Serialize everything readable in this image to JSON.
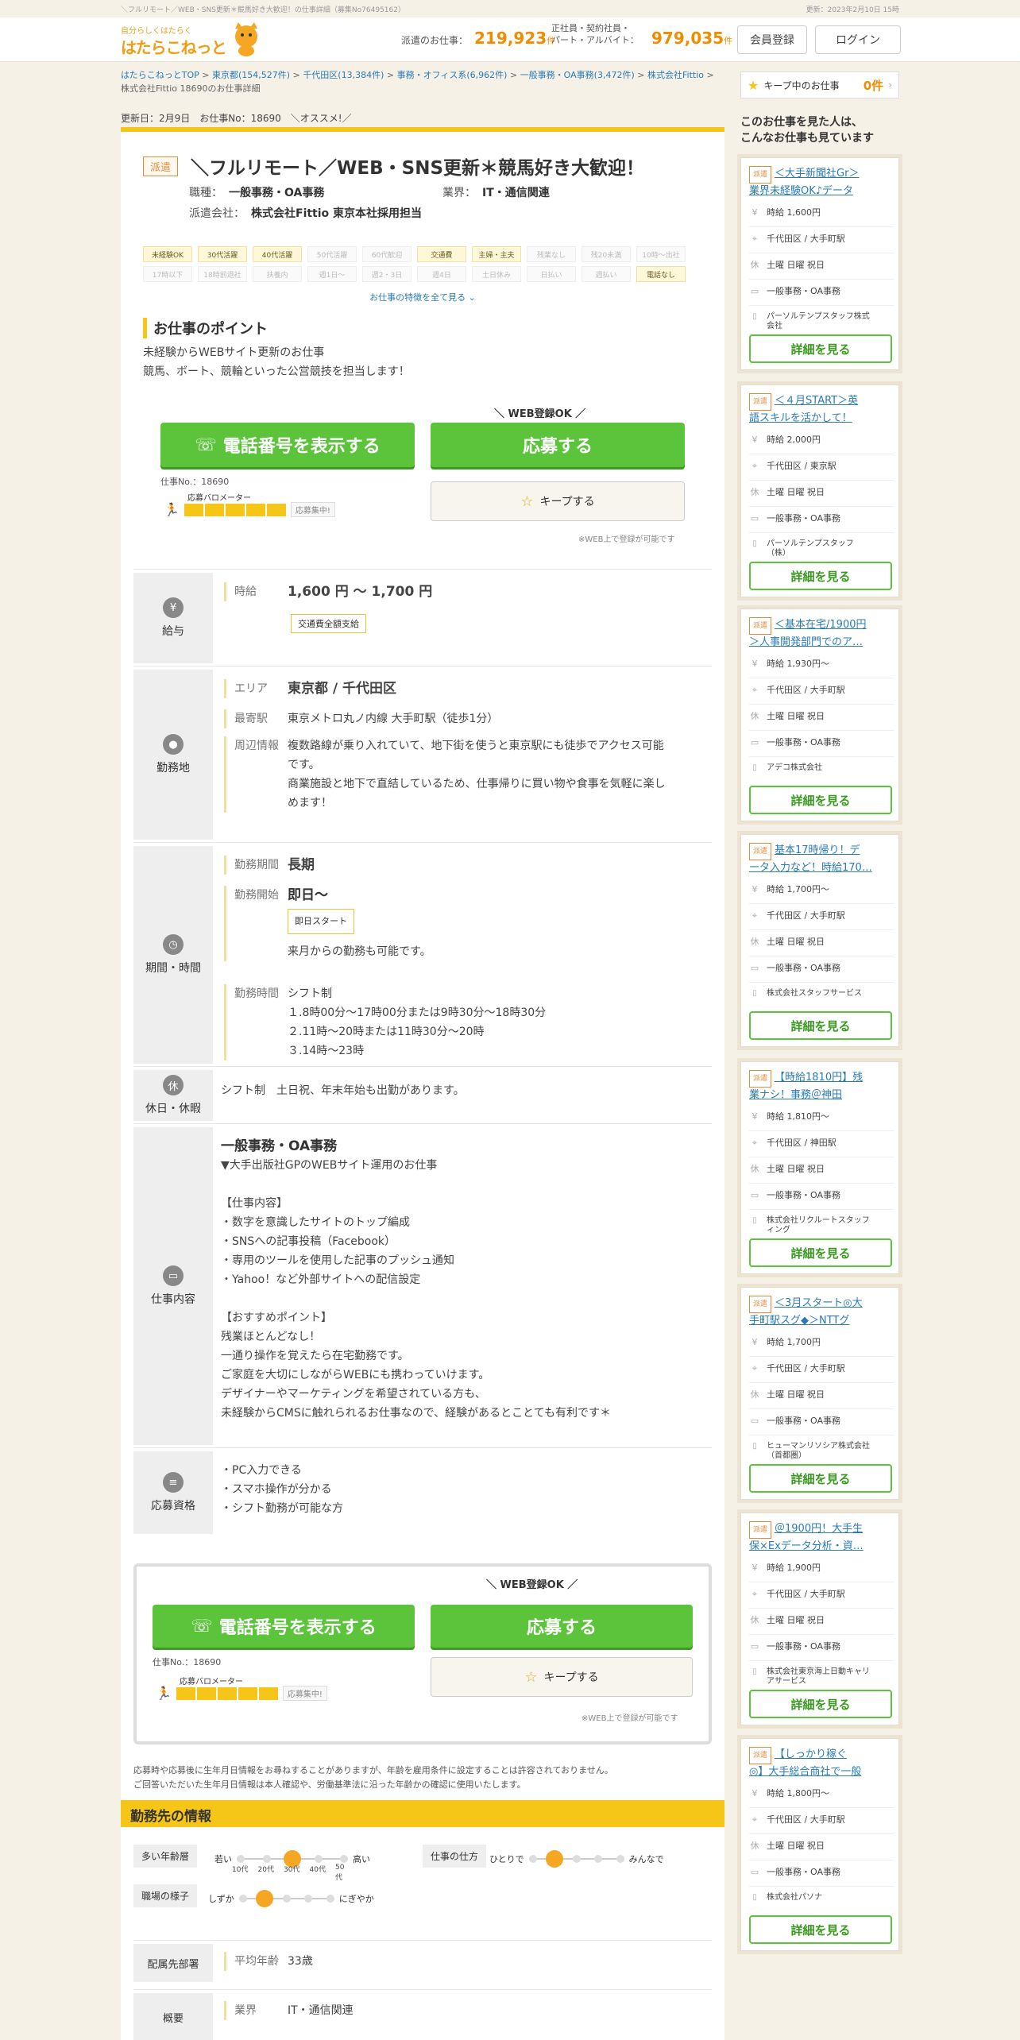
{
  "top": {
    "left": "＼フルリモート／WEB・SNS更新＊競馬好き大歓迎！の仕事詳細（募集No76495162）",
    "right": "更新：2023年2月10日 15時"
  },
  "header": {
    "logo_tagline": "自分らしくはたらく",
    "logo_name": "はたらこねっと",
    "haken_label": "派遣のお仕事：",
    "haken_count": "219,923",
    "seishain_label_1": "正社員・契約社員・",
    "seishain_label_2": "パート・アルバイト：",
    "seishain_count": "979,035",
    "ken": "件",
    "register": "会員登録",
    "login": "ログイン"
  },
  "breadcrumb": [
    "はたらこねっとTOP",
    "東京都(154,527件)",
    "千代田区(13,384件)",
    "事務・オフィス系(6,962件)",
    "一般事務・OA事務(3,472件)",
    "株式会社Fittio",
    "株式会社Fittio 18690のお仕事詳細"
  ],
  "updated": "更新日：2月9日　お仕事No：18690　＼オススメ!／",
  "job": {
    "badge": "派遣",
    "title": "＼フルリモート／WEB・SNS更新＊競馬好き大歓迎！",
    "shokushu_label": "職種：",
    "shokushu": "一般事務・OA事務",
    "gyokai_label": "業界：",
    "gyokai": "IT・通信関連",
    "company_label": "派遣会社：",
    "company": "株式会社Fittio 東京本社採用担当"
  },
  "features": [
    {
      "label": "未経験OK",
      "on": true
    },
    {
      "label": "30代活躍",
      "on": true
    },
    {
      "label": "40代活躍",
      "on": true
    },
    {
      "label": "50代活躍",
      "on": false
    },
    {
      "label": "60代歓迎",
      "on": false
    },
    {
      "label": "交通費",
      "on": true
    },
    {
      "label": "主婦・主夫",
      "on": true
    },
    {
      "label": "残業なし",
      "on": false
    },
    {
      "label": "残20未満",
      "on": false
    },
    {
      "label": "10時～出社",
      "on": false
    },
    {
      "label": "17時以下",
      "on": false
    },
    {
      "label": "18時前退社",
      "on": false
    },
    {
      "label": "扶養内",
      "on": false
    },
    {
      "label": "週1日～",
      "on": false
    },
    {
      "label": "週2・3日",
      "on": false
    },
    {
      "label": "週4日",
      "on": false
    },
    {
      "label": "土日休み",
      "on": false
    },
    {
      "label": "日払い",
      "on": false
    },
    {
      "label": "週払い",
      "on": false
    },
    {
      "label": "電話なし",
      "on": true
    }
  ],
  "more_features": "お仕事の特徴を全て見る ⌄",
  "point": {
    "heading": "お仕事のポイント",
    "line1": "未経験からWEBサイト更新のお仕事",
    "line2": "競馬、ボート、競輪といった公営競技を担当します！"
  },
  "cta": {
    "web_ok": "＼ WEB登録OK ／",
    "phone": "電話番号を表示する",
    "apply": "応募する",
    "keep": "キープする",
    "job_no": "仕事No.：18690",
    "barometer": "応募バロメーター",
    "barometer_status": "応募集中!",
    "barometer_level": 5,
    "note": "※WEB上で登録が可能です"
  },
  "salary": {
    "heading": "給与",
    "label": "時給",
    "value": "1,600 円 ～ 1,700 円",
    "tag": "交通費全額支給"
  },
  "location": {
    "heading": "勤務地",
    "area_label": "エリア",
    "area": "東京都 / 千代田区",
    "station_label": "最寄駅",
    "station": "東京メトロ丸ノ内線 大手町駅（徒歩1分）",
    "info_label": "周辺情報",
    "info1": "複数路線が乗り入れていて、地下街を使うと東京駅にも徒歩でアクセス可能",
    "info2": "です。",
    "info3": "商業施設と地下で直結しているため、仕事帰りに買い物や食事を気軽に楽し",
    "info4": "めます！"
  },
  "period": {
    "heading": "期間・時間",
    "duration_label": "勤務期間",
    "duration": "長期",
    "start_label": "勤務開始",
    "start": "即日～",
    "start_tag": "即日スタート",
    "start_note": "来月からの勤務も可能です。",
    "hours_label": "勤務時間",
    "hours1": "シフト制",
    "hours2": "１.8時00分～17時00分または9時30分～18時30分",
    "hours3": "２.11時～20時または11時30分～20時",
    "hours4": "３.14時～23時"
  },
  "holiday": {
    "heading": "休日・休暇",
    "value": "シフト制　土日祝、年末年始も出勤があります。"
  },
  "content": {
    "heading": "仕事内容",
    "title": "一般事務・OA事務",
    "lines": [
      "▼大手出版社GPのWEBサイト運用のお仕事",
      "",
      "【仕事内容】",
      "・数字を意識したサイトのトップ編成",
      "・SNSへの記事投稿（Facebook）",
      "・専用のツールを使用した記事のプッシュ通知",
      "・Yahoo！など外部サイトへの配信設定",
      "",
      "【おすすめポイント】",
      "残業ほとんどなし！",
      "一通り操作を覚えたら在宅勤務です。",
      "ご家庭を大切にしながらWEBにも携わっていけます。",
      "デザイナーやマーケティングを希望されている方も、",
      "未経験からCMSに触れられるお仕事なので、経験があるとことても有利です＊"
    ]
  },
  "qualification": {
    "heading": "応募資格",
    "l1": "・PC入力できる",
    "l2": "・スマホ操作が分かる",
    "l3": "・シフト勤務が可能な方"
  },
  "disclaimer": {
    "l1": "応募時や応募後に生年月日情報をお尋ねすることがありますが、年齢を雇用条件に設定することは許容されておりません。",
    "l2": "ご回答いただいた生年月日情報は本人確認や、労働基準法に沿った年齢かの確認に使用いたします。"
  },
  "workplace": {
    "heading": "勤務先の情報",
    "age_label": "多い年齢層",
    "age_low": "若い",
    "age_high": "高い",
    "age_ticks": [
      "10代",
      "20代",
      "30代",
      "40代",
      "50代"
    ],
    "age_level": 2,
    "style_label": "仕事の仕方",
    "style_low": "ひとりで",
    "style_high": "みんなで",
    "style_level": 1,
    "mood_label": "職場の様子",
    "mood_low": "しずか",
    "mood_high": "にぎやか",
    "mood_level": 1,
    "dept_label": "配属先部署",
    "avg_age_label": "平均年齢",
    "avg_age": "33歳",
    "overview_label": "概要",
    "industry_label": "業界",
    "industry": "IT・通信関連"
  },
  "sidebar": {
    "keep_label": "キープ中のお仕事",
    "keep_count": "0件",
    "heading1": "このお仕事を見た人は、",
    "heading2": "こんなお仕事も見ています",
    "detail": "詳細を見る",
    "cards": [
      {
        "badge": "派遣",
        "title1": "＜大手新聞社Gr＞",
        "title2": "業界未経験OK♪データ",
        "wage": "時給 1,600円",
        "place": "千代田区 / 大手町駅",
        "off": "土曜 日曜 祝日",
        "job": "一般事務・OA事務",
        "co1": "パーソルテンプスタッフ株式",
        "co2": "会社"
      },
      {
        "badge": "派遣",
        "title1": "＜４月START＞英",
        "title2": "語スキルを活かして！",
        "wage": "時給 2,000円",
        "place": "千代田区 / 東京駅",
        "off": "土曜 日曜 祝日",
        "job": "一般事務・OA事務",
        "co1": "パーソルテンプスタッフ",
        "co2": "（株）"
      },
      {
        "badge": "派遣",
        "title1": "＜基本在宅/1900円",
        "title2": "＞人事開発部門でのア…",
        "wage": "時給 1,930円～",
        "place": "千代田区 / 大手町駅",
        "off": "土曜 日曜 祝日",
        "job": "一般事務・OA事務",
        "co1": "アデコ株式会社",
        "co2": ""
      },
      {
        "badge": "派遣",
        "title1": "基本17時帰り！デ",
        "title2": "ータ入力など！時給170…",
        "wage": "時給 1,700円～",
        "place": "千代田区 / 大手町駅",
        "off": "土曜 日曜 祝日",
        "job": "一般事務・OA事務",
        "co1": "株式会社スタッフサービス",
        "co2": ""
      },
      {
        "badge": "派遣",
        "title1": "【時給1810円】残",
        "title2": "業ナシ！事務＠神田",
        "wage": "時給 1,810円～",
        "place": "千代田区 / 神田駅",
        "off": "土曜 日曜 祝日",
        "job": "一般事務・OA事務",
        "co1": "株式会社リクルートスタッフ",
        "co2": "ィング"
      },
      {
        "badge": "派遣",
        "title1": "＜3月スタート◎大",
        "title2": "手町駅スグ◆＞NTTグ",
        "wage": "時給 1,700円",
        "place": "千代田区 / 大手町駅",
        "off": "土曜 日曜 祝日",
        "job": "一般事務・OA事務",
        "co1": "ヒューマンリソシア株式会社",
        "co2": "（首都圏）"
      },
      {
        "badge": "派遣",
        "title1": "＠1900円！大手生",
        "title2": "保×Exデータ分析・資…",
        "wage": "時給 1,900円",
        "place": "千代田区 / 大手町駅",
        "off": "土曜 日曜 祝日",
        "job": "一般事務・OA事務",
        "co1": "株式会社東京海上日動キャリ",
        "co2": "アサービス"
      },
      {
        "badge": "派遣",
        "title1": "【しっかり稼ぐ",
        "title2": "◎】大手総合商社で一般",
        "wage": "時給 1,800円～",
        "place": "千代田区 / 大手町駅",
        "off": "土曜 日曜 祝日",
        "job": "一般事務・OA事務",
        "co1": "株式会社パソナ",
        "co2": ""
      }
    ]
  },
  "colors": {
    "accent": "#f5c518",
    "green": "#5cc43a",
    "orange": "#f08c00",
    "link": "#2a7ab8"
  }
}
